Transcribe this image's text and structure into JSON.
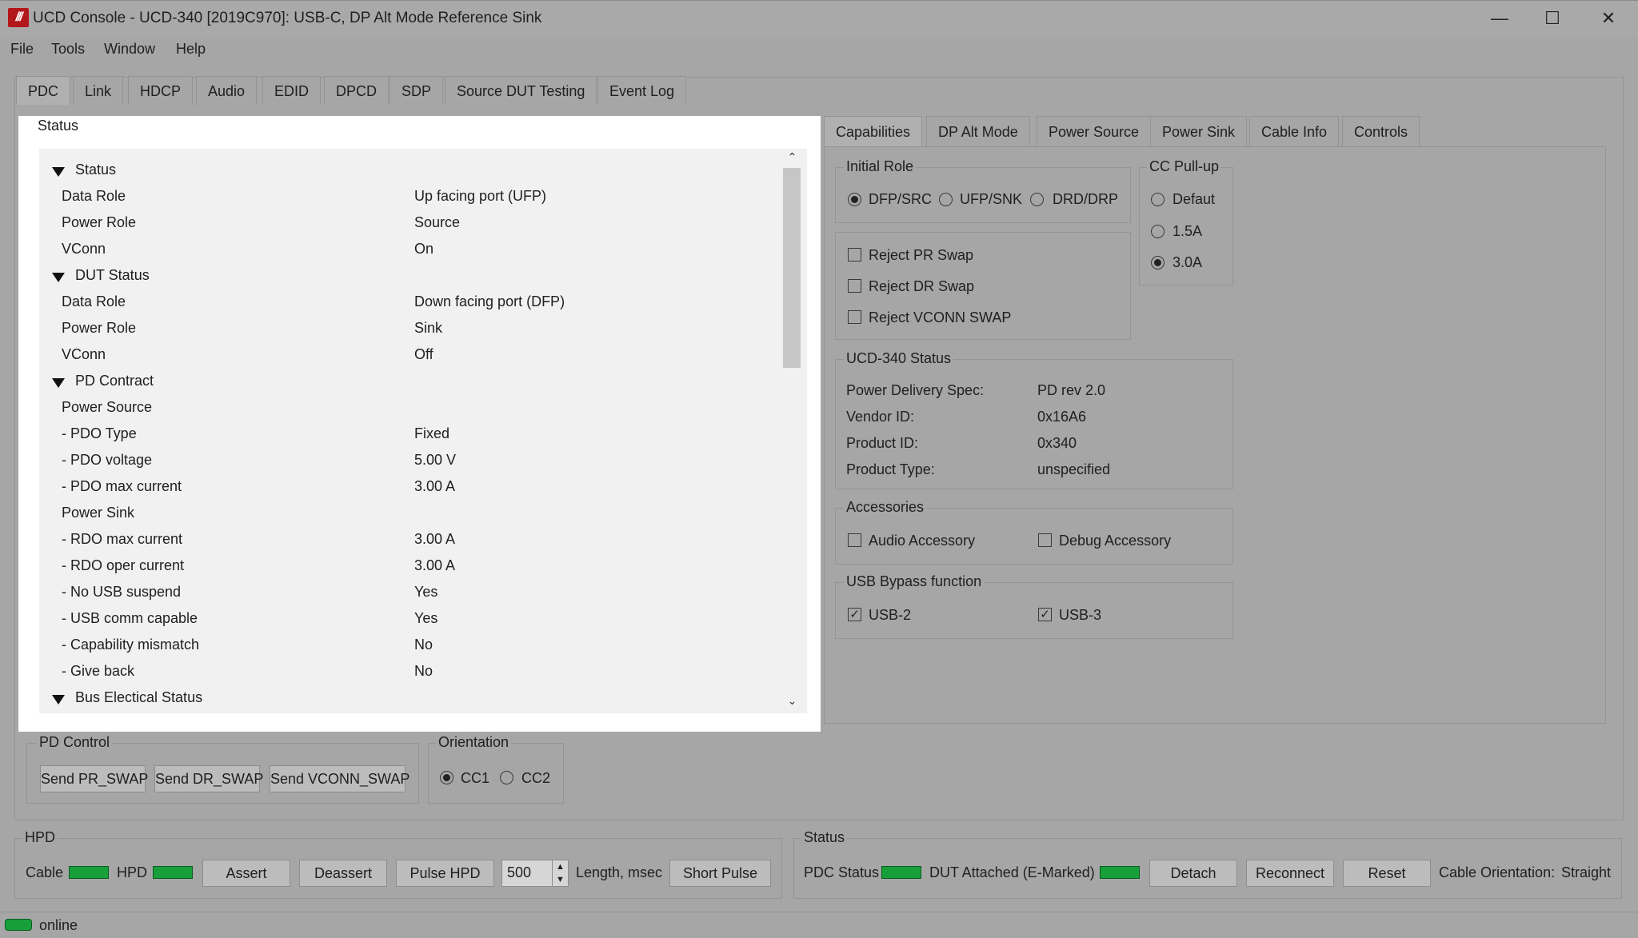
{
  "window": {
    "title": "UCD Console - UCD-340 [2019C970]: USB-C, DP Alt Mode Reference Sink",
    "logo_text": "///",
    "min_glyph": "—",
    "max_glyph": "☐",
    "close_glyph": "✕"
  },
  "menu": [
    "File",
    "Tools",
    "Window",
    "Help"
  ],
  "main_tabs": [
    "PDC",
    "Link",
    "HDCP",
    "Audio",
    "EDID",
    "DPCD",
    "SDP",
    "Source DUT Testing",
    "Event Log"
  ],
  "status_panel": {
    "title": "Status",
    "rows": [
      {
        "key": "Status",
        "value": "",
        "header": true
      },
      {
        "key": "Data Role",
        "value": "Up facing port (UFP)"
      },
      {
        "key": "Power Role",
        "value": "Source"
      },
      {
        "key": "VConn",
        "value": "On"
      },
      {
        "key": "DUT Status",
        "value": "",
        "header": true
      },
      {
        "key": "Data Role",
        "value": "Down facing port (DFP)"
      },
      {
        "key": "Power Role",
        "value": "Sink"
      },
      {
        "key": "VConn",
        "value": "Off"
      },
      {
        "key": "PD Contract",
        "value": "",
        "header": true
      },
      {
        "key": "Power Source",
        "value": ""
      },
      {
        "key": "- PDO Type",
        "value": "Fixed"
      },
      {
        "key": "- PDO voltage",
        "value": "5.00 V"
      },
      {
        "key": "- PDO max current",
        "value": "3.00 A"
      },
      {
        "key": "Power Sink",
        "value": ""
      },
      {
        "key": "- RDO max current",
        "value": "3.00 A"
      },
      {
        "key": "- RDO oper current",
        "value": "3.00 A"
      },
      {
        "key": "- No USB suspend",
        "value": "Yes"
      },
      {
        "key": "- USB comm capable",
        "value": "Yes"
      },
      {
        "key": "- Capability mismatch",
        "value": "No"
      },
      {
        "key": "- Give back",
        "value": "No"
      },
      {
        "key": "Bus Electical Status",
        "value": "",
        "header": true
      }
    ],
    "scroll_up": "⌃",
    "scroll_down": "⌄"
  },
  "right_tabs": [
    "Capabilities",
    "DP Alt Mode",
    "Power Source",
    "Power Sink",
    "Cable Info",
    "Controls"
  ],
  "initial_role": {
    "label": "Initial Role",
    "options": [
      {
        "label": "DFP/SRC",
        "selected": true
      },
      {
        "label": "UFP/SNK",
        "selected": false
      },
      {
        "label": "DRD/DRP",
        "selected": false
      }
    ]
  },
  "cc_pullup": {
    "label": "CC Pull-up",
    "options": [
      {
        "label": "Defaut",
        "selected": false
      },
      {
        "label": "1.5A",
        "selected": false
      },
      {
        "label": "3.0A",
        "selected": true
      }
    ]
  },
  "reject": [
    {
      "label": "Reject PR Swap",
      "checked": false
    },
    {
      "label": "Reject DR Swap",
      "checked": false
    },
    {
      "label": "Reject VCONN SWAP",
      "checked": false
    }
  ],
  "ucd_status": {
    "label": "UCD-340 Status",
    "rows": [
      {
        "key": "Power Delivery Spec:",
        "value": "PD rev 2.0"
      },
      {
        "key": "Vendor ID:",
        "value": "0x16A6"
      },
      {
        "key": "Product ID:",
        "value": "0x340"
      },
      {
        "key": "Product Type:",
        "value": "unspecified"
      }
    ]
  },
  "accessories": {
    "label": "Accessories",
    "items": [
      {
        "label": "Audio Accessory",
        "checked": false
      },
      {
        "label": "Debug Accessory",
        "checked": false
      }
    ]
  },
  "usb_bypass": {
    "label": "USB Bypass function",
    "items": [
      {
        "label": "USB-2",
        "checked": true
      },
      {
        "label": "USB-3",
        "checked": true
      }
    ]
  },
  "pd_control": {
    "label": "PD Control",
    "buttons": [
      "Send PR_SWAP",
      "Send DR_SWAP",
      "Send VCONN_SWAP"
    ]
  },
  "orientation": {
    "label": "Orientation",
    "options": [
      {
        "label": "CC1",
        "selected": true
      },
      {
        "label": "CC2",
        "selected": false
      }
    ]
  },
  "hpd": {
    "label": "HPD",
    "cable_label": "Cable",
    "hpd_label": "HPD",
    "assert": "Assert",
    "deassert": "Deassert",
    "pulse": "Pulse HPD",
    "length_value": "500",
    "length_label": "Length, msec",
    "short_pulse": "Short Pulse"
  },
  "status_box": {
    "label": "Status",
    "pdc_status": "PDC Status",
    "dut_attached": "DUT Attached (E-Marked)",
    "detach": "Detach",
    "reconnect": "Reconnect",
    "reset": "Reset",
    "cable_orientation_label": "Cable Orientation:",
    "cable_orientation_value": "Straight"
  },
  "statusbar": {
    "text": "online"
  },
  "colors": {
    "led_green": "#17a03a",
    "highlight_panel": "#ffffff",
    "logo_red": "#b2171c"
  }
}
